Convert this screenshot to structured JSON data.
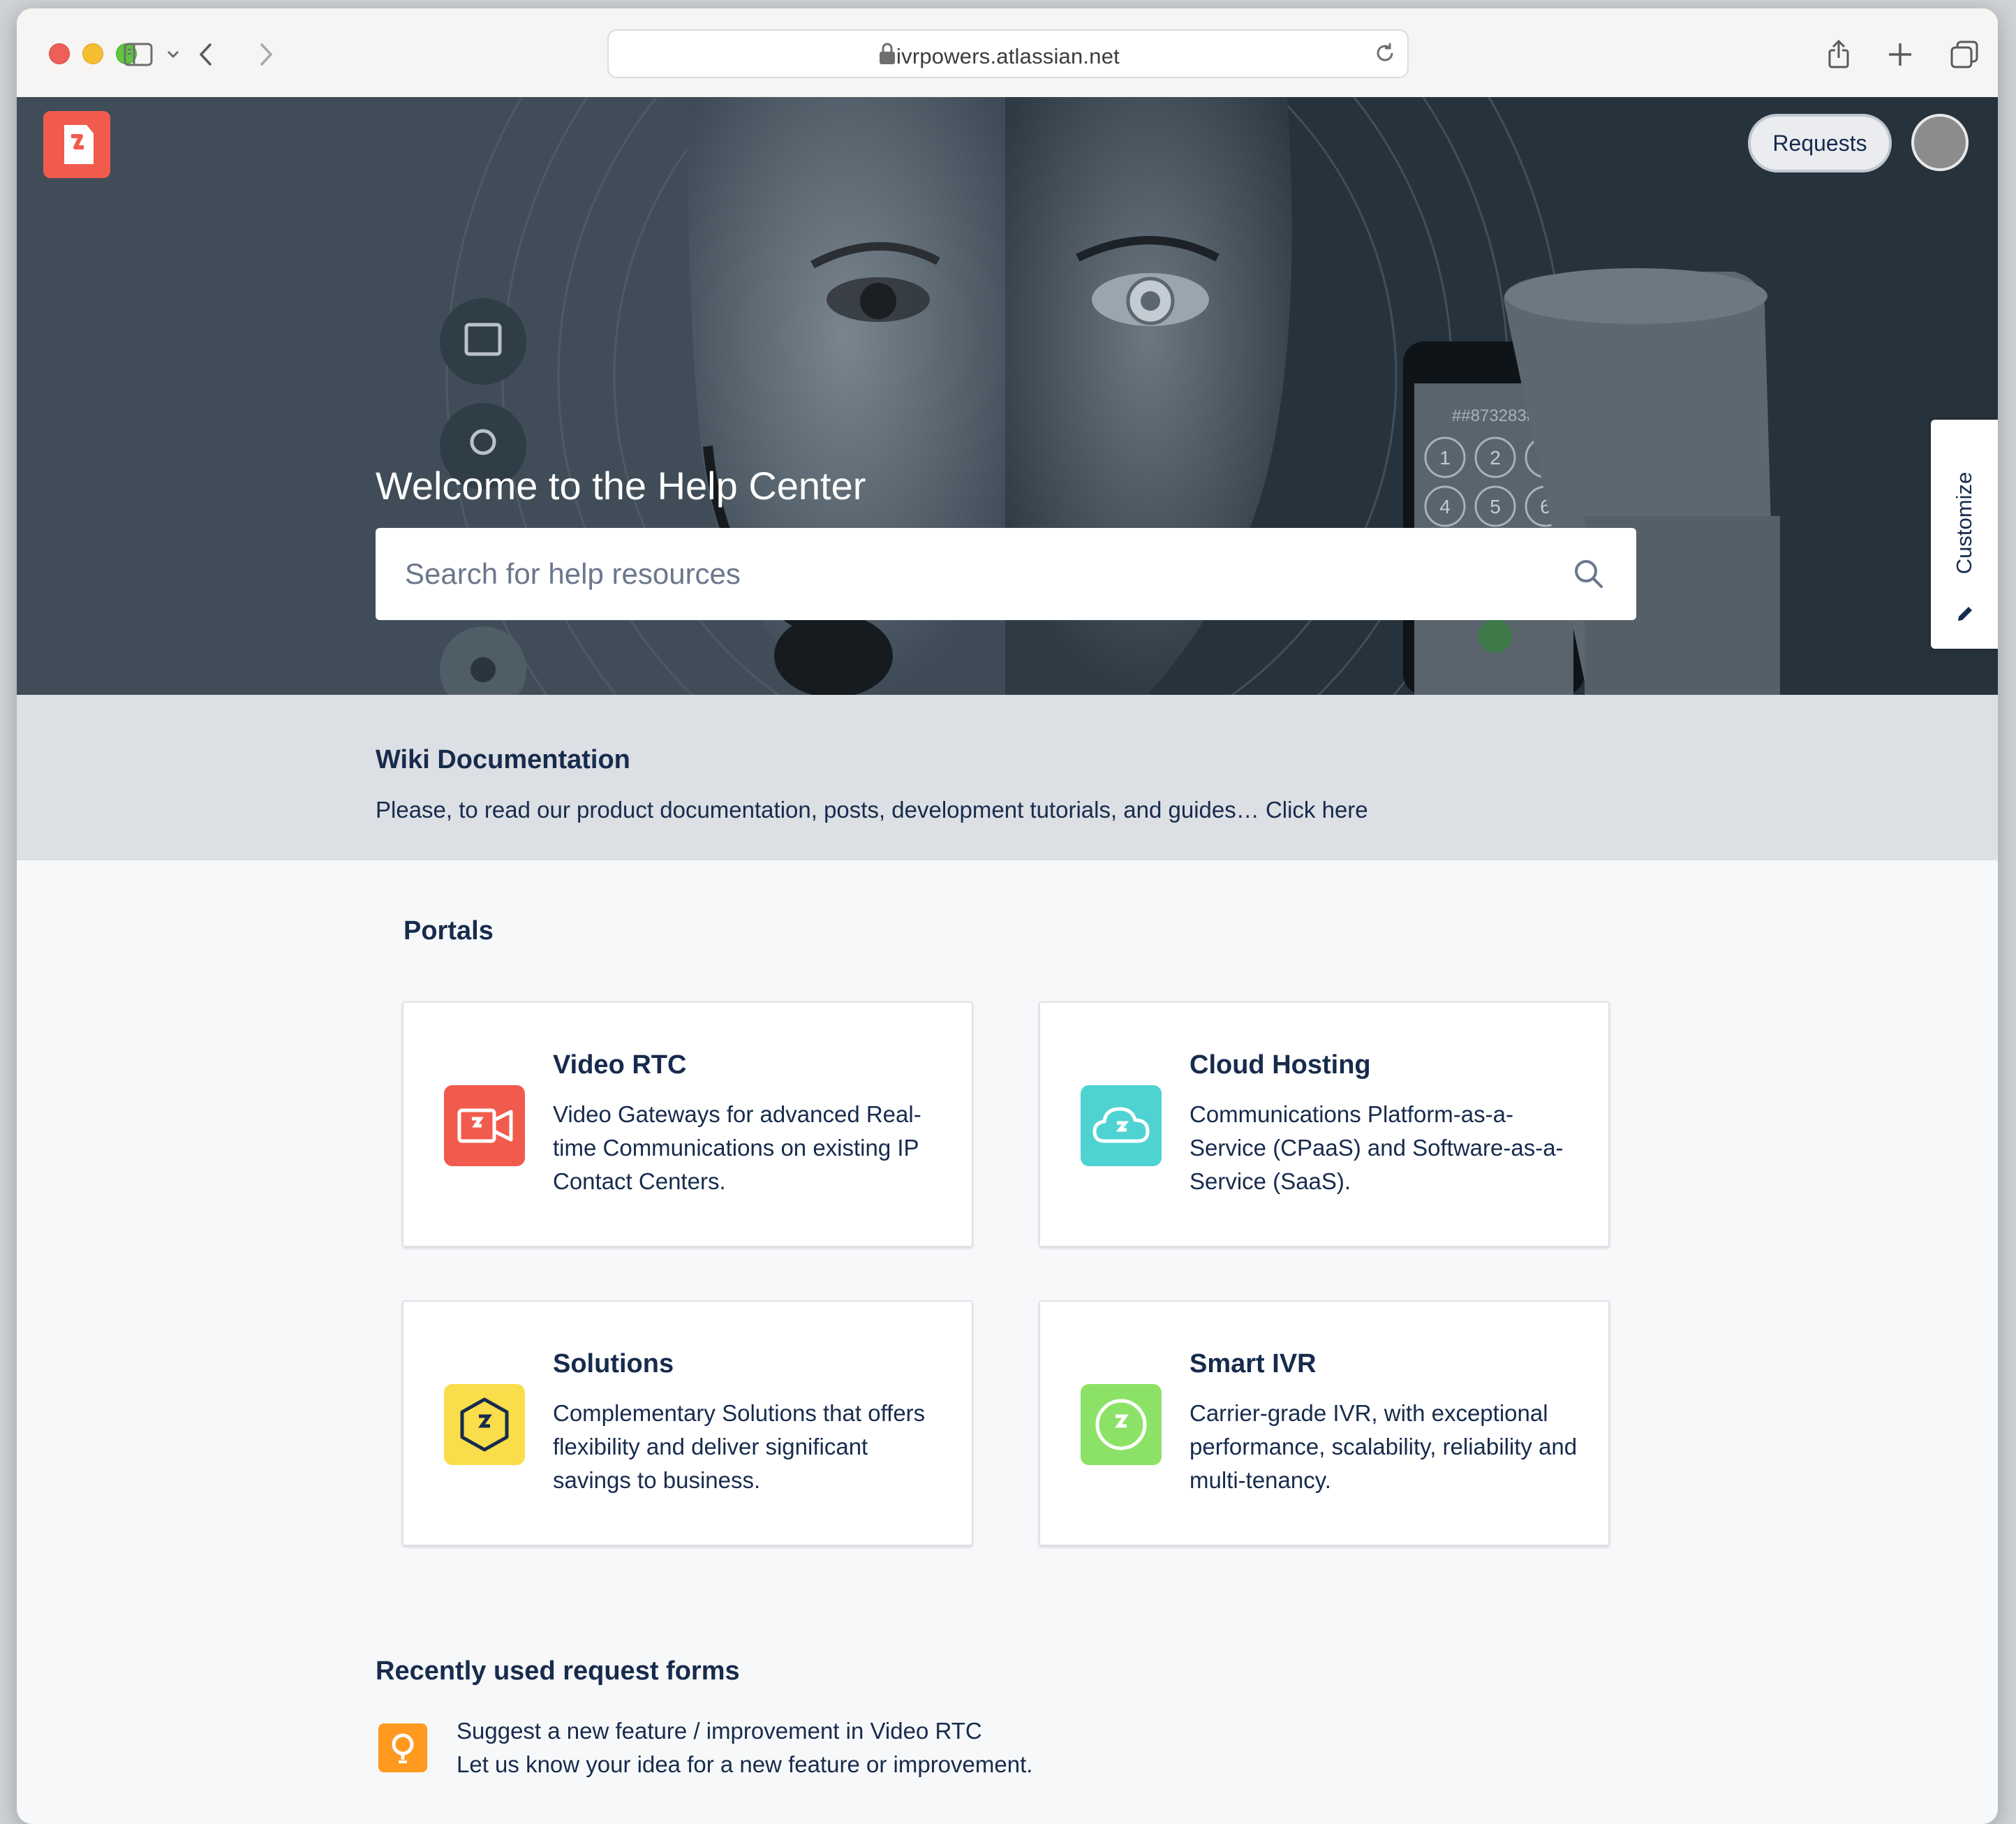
{
  "browser": {
    "url": "ivrpowers.atlassian.net"
  },
  "header": {
    "requests_label": "Requests",
    "customize_label": "Customize"
  },
  "hero": {
    "welcome": "Welcome to the Help Center",
    "search_placeholder": "Search for help resources",
    "phone_display": "##873283#",
    "keypad": [
      "1",
      "2",
      "3",
      "4",
      "5",
      "6"
    ]
  },
  "wiki": {
    "title": "Wiki Documentation",
    "text": "Please, to read our product documentation, posts, development tutorials, and guides… ",
    "link": "Click here"
  },
  "portals": {
    "title": "Portals",
    "items": [
      {
        "title": "Video RTC",
        "description": "Video Gateways for advanced Real-time Communications on existing IP Contact Centers.",
        "icon": "video-camera-icon",
        "color": "#f15b4e"
      },
      {
        "title": "Cloud Hosting",
        "description": "Communications Platform-as-a-Service (CPaaS) and Software-as-a-Service (SaaS).",
        "icon": "cloud-icon",
        "color": "#4fd3d2"
      },
      {
        "title": "Solutions",
        "description": "Complementary Solutions that offers flexibility and deliver significant savings to business.",
        "icon": "hexagon-icon",
        "color": "#f9dd4b"
      },
      {
        "title": "Smart IVR",
        "description": "Carrier-grade IVR, with exceptional performance, scalability, reliability and multi-tenancy.",
        "icon": "circle-arrow-icon",
        "color": "#8ce266"
      }
    ]
  },
  "recent": {
    "title": "Recently used request forms",
    "items": [
      {
        "name": "Suggest a new feature / improvement in Video RTC",
        "description": "Let us know your idea for a new feature or improvement.",
        "icon": "lightbulb-icon",
        "color": "#ff991f"
      }
    ]
  }
}
